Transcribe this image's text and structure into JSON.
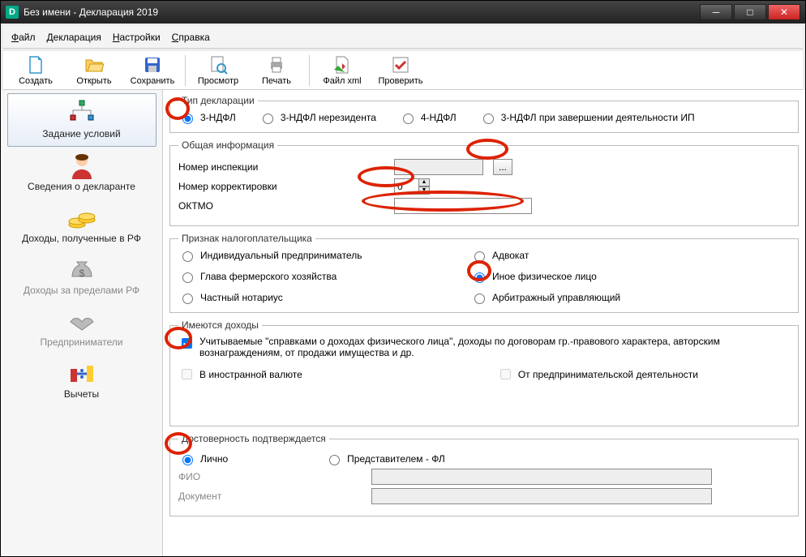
{
  "window": {
    "title": "Без имени - Декларация 2019"
  },
  "menu": {
    "file": "Файл",
    "declaration": "Декларация",
    "settings": "Настройки",
    "help": "Справка"
  },
  "toolbar": {
    "create": "Создать",
    "open": "Открыть",
    "save": "Сохранить",
    "preview": "Просмотр",
    "print": "Печать",
    "xml": "Файл xml",
    "check": "Проверить"
  },
  "sidebar": {
    "conditions": "Задание условий",
    "declarant": "Сведения о декларанте",
    "income_rf": "Доходы, полученные в РФ",
    "income_foreign": "Доходы за пределами РФ",
    "entrepreneurs": "Предприниматели",
    "deductions": "Вычеты"
  },
  "decl_type": {
    "legend": "Тип декларации",
    "opt1": "3-НДФЛ",
    "opt2": "3-НДФЛ нерезидента",
    "opt3": "4-НДФЛ",
    "opt4": "3-НДФЛ при завершении деятельности ИП"
  },
  "general": {
    "legend": "Общая информация",
    "inspection_label": "Номер инспекции",
    "inspection_value": "",
    "correction_label": "Номер корректировки",
    "correction_value": "0",
    "oktmo_label": "ОКТМО",
    "oktmo_value": "",
    "dots": "..."
  },
  "taxpayer_sign": {
    "legend": "Признак налогоплательщика",
    "ip": "Индивидуальный предприниматель",
    "advocate": "Адвокат",
    "farmer": "Глава фермерского хозяйства",
    "other_person": "Иное физическое лицо",
    "notary": "Частный нотариус",
    "arbitr": "Арбитражный управляющий"
  },
  "have_income": {
    "legend": "Имеются доходы",
    "by_refs": "Учитываемые \"справками о доходах физического лица\", доходы по договорам гр.-правового характера, авторским вознаграждениям, от продажи имущества и др.",
    "foreign": "В иностранной валюте",
    "business": "От предпринимательской деятельности"
  },
  "confirm": {
    "legend": "Достоверность подтверждается",
    "personal": "Лично",
    "rep": "Представителем - ФЛ",
    "fio": "ФИО",
    "doc": "Документ"
  }
}
